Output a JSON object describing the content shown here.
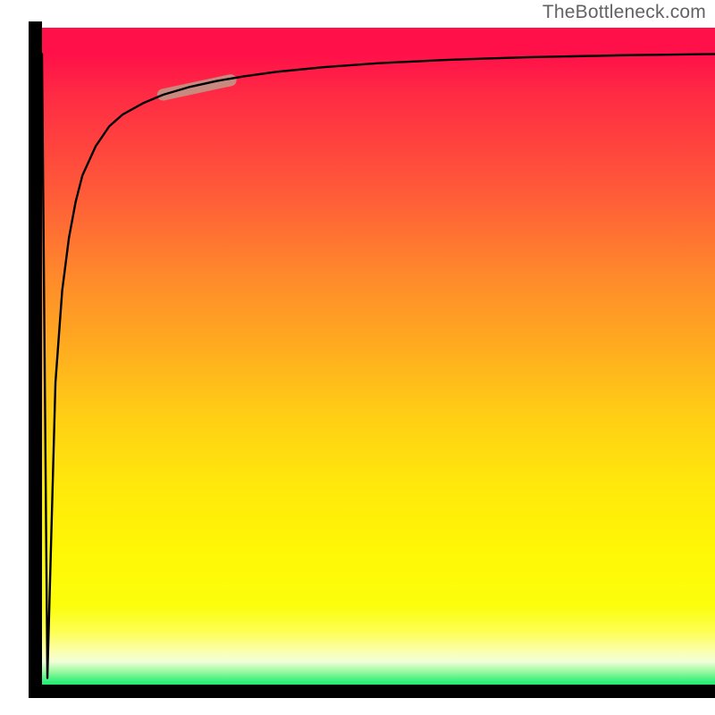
{
  "attribution": "TheBottleneck.com",
  "colors": {
    "axis": "#000000",
    "curve": "#000000",
    "highlight": "#c8897f",
    "attribution": "#626262",
    "gradient_top": "#ff1049",
    "gradient_mid_upper": "#ff8a2b",
    "gradient_mid_lower": "#fff805",
    "gradient_bottom": "#1ced73"
  },
  "chart_data": {
    "type": "line",
    "title": "",
    "xlabel": "",
    "ylabel": "",
    "xlim": [
      0,
      100
    ],
    "ylim": [
      0,
      100
    ],
    "x": [
      0,
      0.8,
      2,
      3,
      4,
      5,
      6,
      8,
      10,
      12,
      15,
      18,
      22,
      26,
      30,
      35,
      42,
      50,
      60,
      72,
      86,
      100
    ],
    "values": [
      96,
      1,
      46,
      60,
      68,
      73.5,
      77.5,
      82,
      85,
      86.8,
      88.5,
      89.8,
      91,
      91.9,
      92.6,
      93.3,
      94,
      94.6,
      95.1,
      95.5,
      95.8,
      96
    ],
    "highlight_segment": {
      "x_start": 18,
      "x_end": 28,
      "y_start": 89.8,
      "y_end": 92.0
    },
    "legend": [],
    "grid": false
  }
}
